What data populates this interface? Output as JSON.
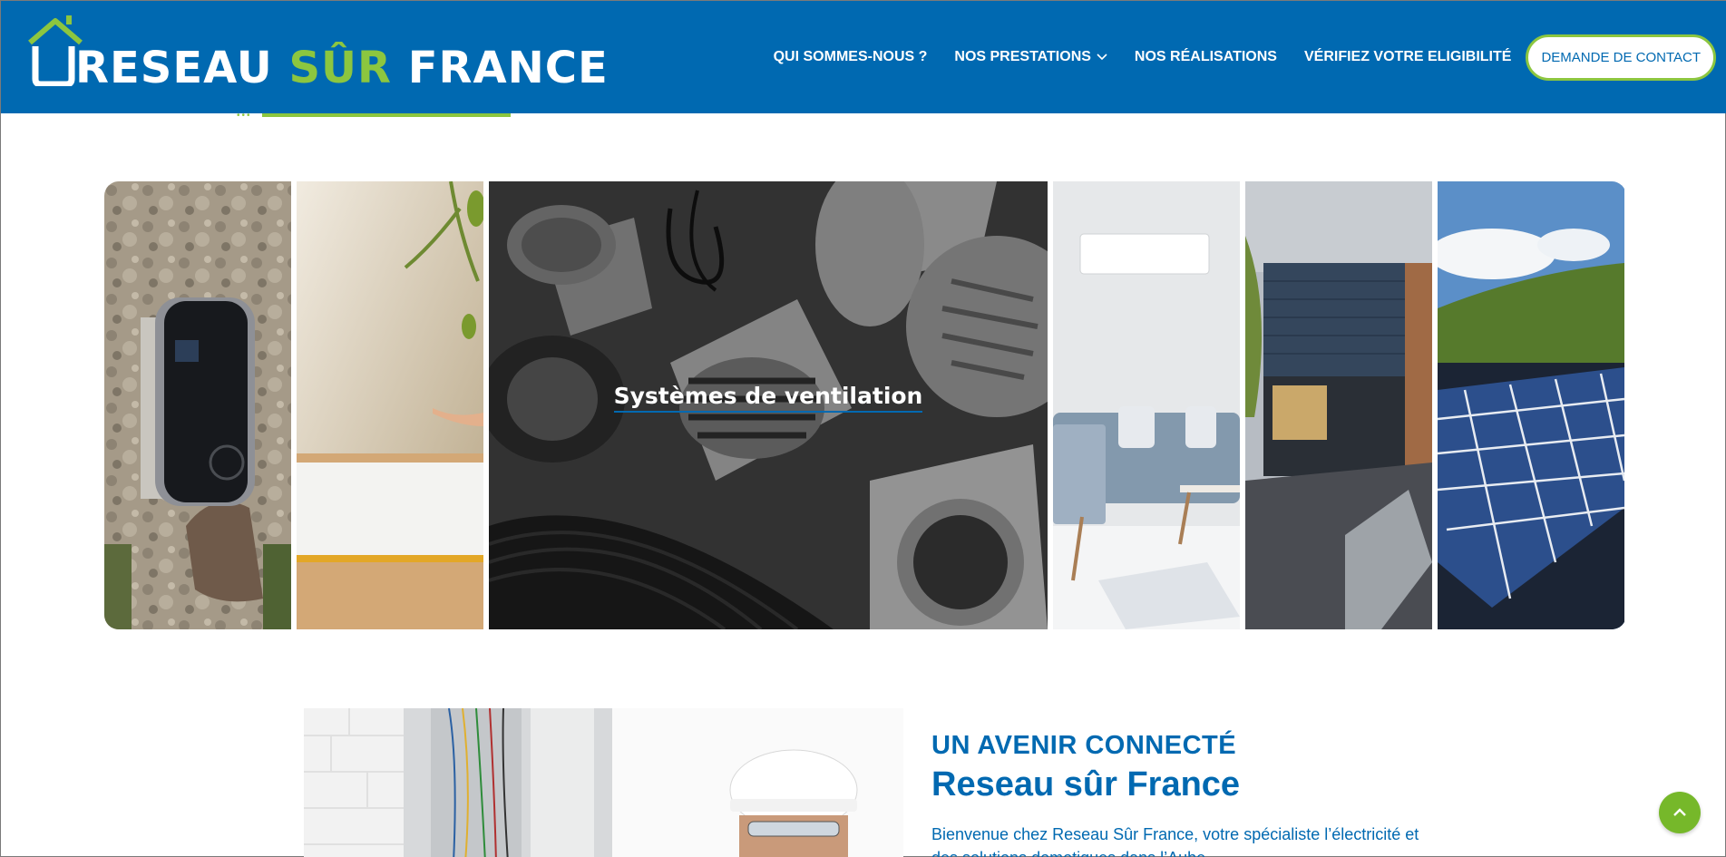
{
  "header": {
    "logo": {
      "text_part1": "RESEAU",
      "text_part2": "SÛR",
      "text_part3": "FRANCE",
      "alt_name": "Reseau Sûr France"
    },
    "nav": [
      {
        "label": "QUI SOMMES-NOUS ?",
        "has_dropdown": false
      },
      {
        "label": "NOS PRESTATIONS",
        "has_dropdown": true
      },
      {
        "label": "NOS RÉALISATIONS",
        "has_dropdown": false
      },
      {
        "label": "VÉRIFIEZ VOTRE ELIGIBILITÉ",
        "has_dropdown": false
      }
    ],
    "contact_button": "DEMANDE DE CONTACT"
  },
  "gallery": {
    "active_caption": "Systèmes de ventilation",
    "panels": [
      "ev-charger",
      "home-automation",
      "ventilation",
      "air-conditioning",
      "roller-shutters",
      "solar-panels"
    ]
  },
  "about": {
    "kicker": "UN AVENIR CONNECTÉ",
    "title": "Reseau sûr France",
    "text": "Bienvenue chez Reseau Sûr France, votre spécialiste l’électricité et des solutions domotiques dans l’Aube"
  },
  "icons": {
    "scroll_top": "chevron-up-icon",
    "dropdown": "chevron-down-icon"
  },
  "colors": {
    "brand_blue": "#0069b1",
    "brand_green": "#8cc63f",
    "top_button": "#76b82a"
  }
}
